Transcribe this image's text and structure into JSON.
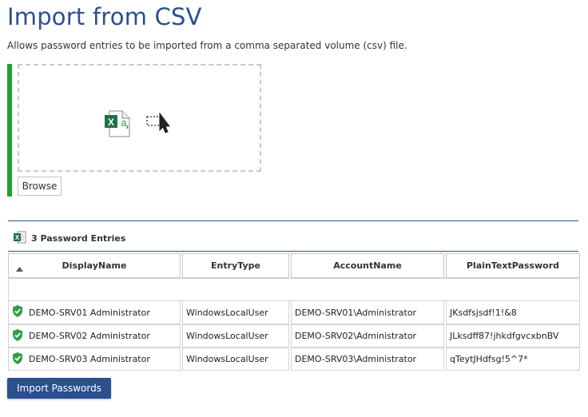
{
  "page": {
    "title": "Import from CSV",
    "subtitle": "Allows password entries to be imported from a comma separated volume (csv) file."
  },
  "upload": {
    "browse_label": "Browse",
    "file_icon": "excel-csv-file-icon",
    "select_icon": "select-cursor-icon"
  },
  "entries": {
    "count_label": "3 Password Entries",
    "icon": "excel-icon",
    "columns": [
      "DisplayName",
      "EntryType",
      "AccountName",
      "PlainTextPassword"
    ],
    "rows": [
      {
        "display_name": "DEMO-SRV01 Administrator",
        "entry_type": "WindowsLocalUser",
        "account_name": "DEMO-SRV01\\Administrator",
        "password": "JKsdfsjsdf!1!&8"
      },
      {
        "display_name": "DEMO-SRV02 Administrator",
        "entry_type": "WindowsLocalUser",
        "account_name": "DEMO-SRV02\\Administrator",
        "password": "JLksdff87!jhkdfgvcxbnBV"
      },
      {
        "display_name": "DEMO-SRV03 Administrator",
        "entry_type": "WindowsLocalUser",
        "account_name": "DEMO-SRV03\\Administrator",
        "password": "qTeytJHdfsg!5^7*"
      }
    ]
  },
  "actions": {
    "import_label": "Import Passwords"
  },
  "colors": {
    "accent": "#2b4f8f",
    "status_green": "#1ea32a",
    "excel_green": "#1f7244"
  }
}
